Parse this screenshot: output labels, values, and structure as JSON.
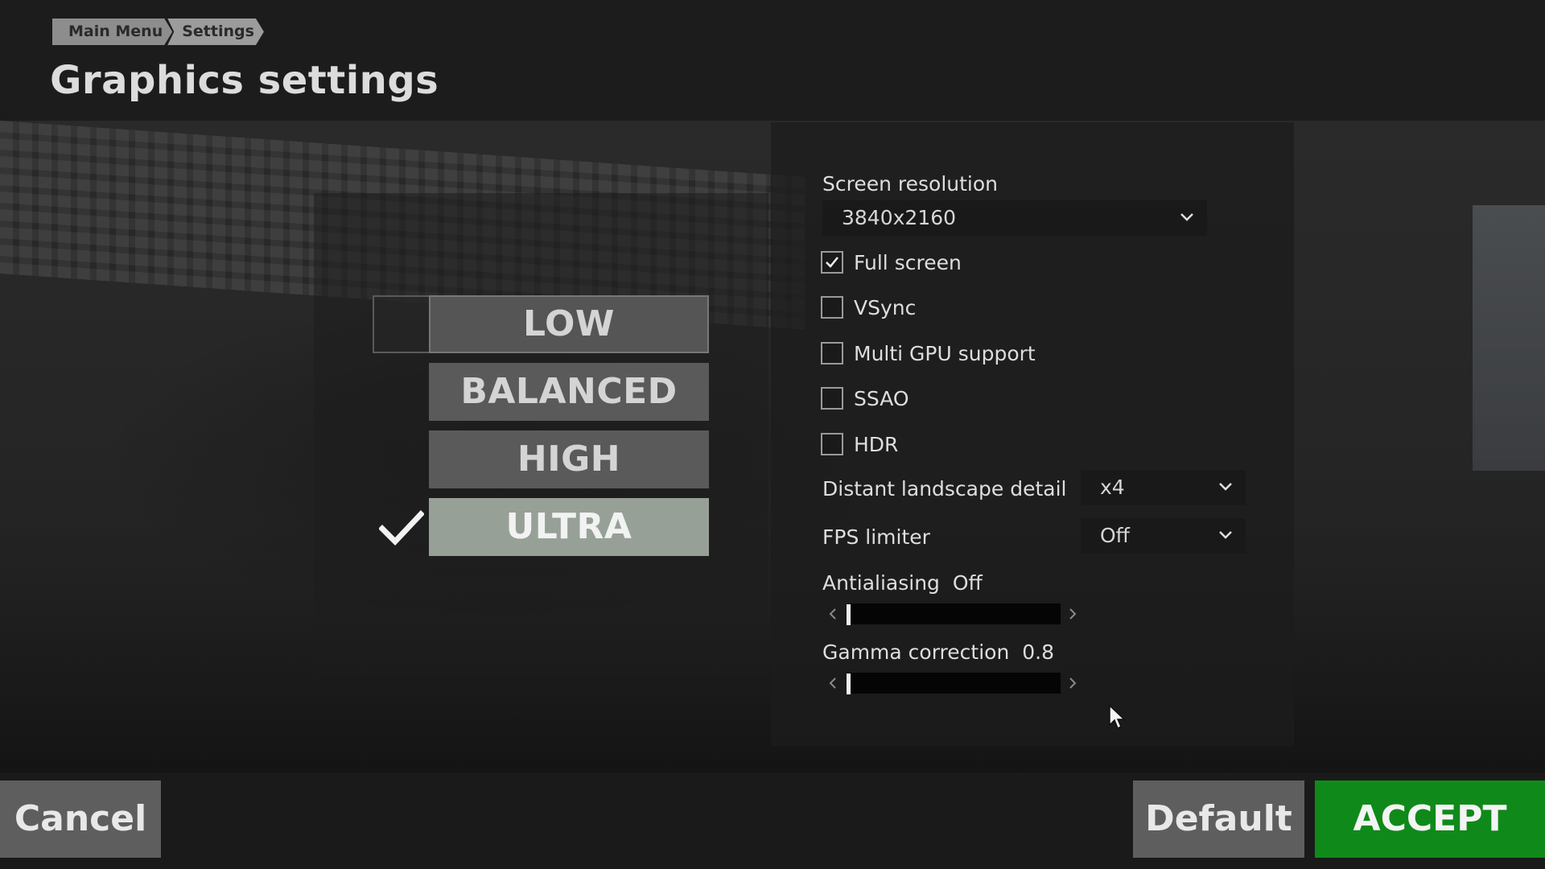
{
  "breadcrumb": {
    "items": [
      "Main Menu",
      "Settings"
    ]
  },
  "page": {
    "title": "Graphics settings"
  },
  "presets": [
    {
      "label": "LOW",
      "selected": false,
      "focused": true
    },
    {
      "label": "BALANCED",
      "selected": false,
      "focused": false
    },
    {
      "label": "HIGH",
      "selected": false,
      "focused": false
    },
    {
      "label": "ULTRA",
      "selected": true,
      "focused": false
    }
  ],
  "settings": {
    "resolution": {
      "label": "Screen resolution",
      "value": "3840x2160"
    },
    "checkboxes": [
      {
        "label": "Full screen",
        "checked": true
      },
      {
        "label": "VSync",
        "checked": false
      },
      {
        "label": "Multi GPU support",
        "checked": false
      },
      {
        "label": "SSAO",
        "checked": false
      },
      {
        "label": "HDR",
        "checked": false
      }
    ],
    "landscape": {
      "label": "Distant landscape detail",
      "value": "x4"
    },
    "fps": {
      "label": "FPS limiter",
      "value": "Off"
    },
    "antialiasing": {
      "label": "Antialiasing",
      "value": "Off",
      "level": 0
    },
    "gamma": {
      "label": "Gamma correction",
      "value": "0.8",
      "level": 0
    }
  },
  "buttons": {
    "cancel": "Cancel",
    "default": "Default",
    "accept": "ACCEPT"
  },
  "colors": {
    "accept": "#0f8a1a",
    "preset_active": "#97a097",
    "preset_inactive": "#5a5a5a"
  }
}
